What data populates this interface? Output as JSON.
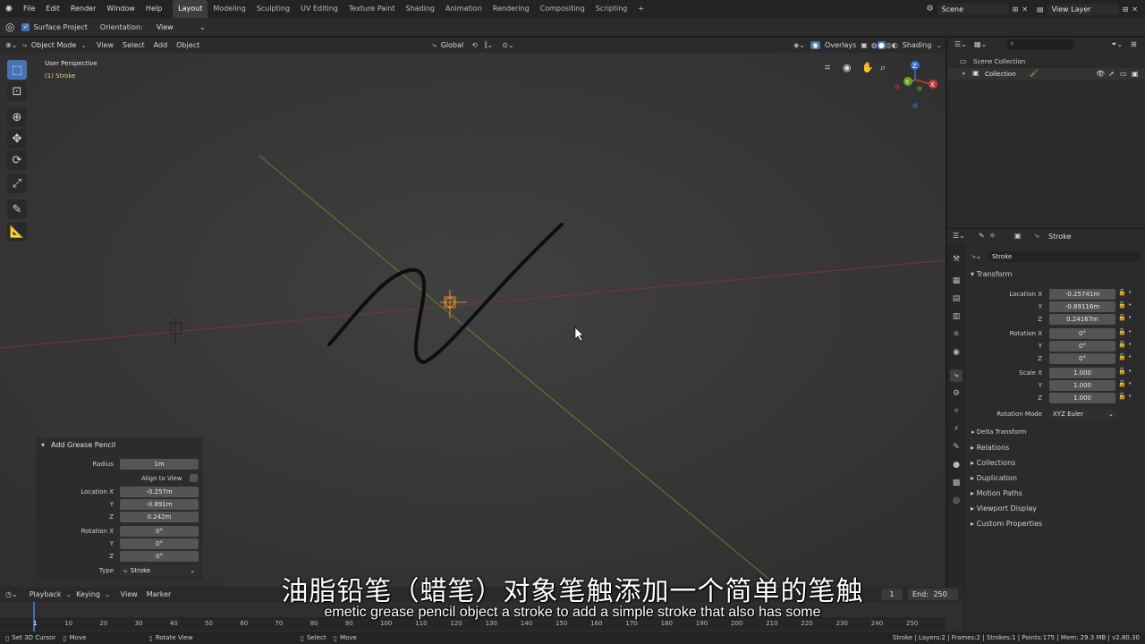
{
  "topbar": {
    "menus": [
      "File",
      "Edit",
      "Render",
      "Window",
      "Help"
    ],
    "workspaces": [
      "Layout",
      "Modeling",
      "Sculpting",
      "UV Editing",
      "Texture Paint",
      "Shading",
      "Animation",
      "Rendering",
      "Compositing",
      "Scripting"
    ],
    "add_tab": "+",
    "scene": "Scene",
    "view_layer": "View Layer"
  },
  "toolsettings": {
    "surface_project": "Surface Project",
    "orientation_label": "Orientation:",
    "orientation_value": "View"
  },
  "viewport_header": {
    "mode": "Object Mode",
    "menus": [
      "View",
      "Select",
      "Add",
      "Object"
    ],
    "transform": "Global",
    "overlays": "Overlays",
    "shading": "Shading"
  },
  "viewport": {
    "perspective": "User Perspective",
    "object_info": "(1) Stroke",
    "gizmo": {
      "x": "X",
      "y": "Y",
      "z": "Z"
    }
  },
  "operator_panel": {
    "title": "Add Grease Pencil",
    "radius_label": "Radius",
    "radius": "1m",
    "align_label": "Align to View",
    "location_x_label": "Location X",
    "location_x": "-0.257m",
    "y_label": "Y",
    "location_y": "-0.891m",
    "z_label": "Z",
    "location_z": "0.242m",
    "rotation_x_label": "Rotation X",
    "rotation_x": "0°",
    "rotation_y": "0°",
    "rotation_z": "0°",
    "type_label": "Type",
    "type_value": "Stroke"
  },
  "outliner": {
    "scene_collection": "Scene Collection",
    "collection": "Collection"
  },
  "properties": {
    "header_object": "Stroke",
    "object_name": "Stroke",
    "transform": "Transform",
    "location_x_label": "Location X",
    "location_x": "-0.25741m",
    "location_y": "-0.89116m",
    "location_z": "0.24167m",
    "rotation_x_label": "Rotation X",
    "rotation_x": "0°",
    "rotation_y": "0°",
    "rotation_z": "0°",
    "scale_x_label": "Scale X",
    "scale_x": "1.000",
    "scale_y": "1.000",
    "scale_z": "1.000",
    "y_label": "Y",
    "z_label": "Z",
    "rotation_mode_label": "Rotation Mode",
    "rotation_mode": "XYZ Euler",
    "delta_transform": "Delta Transform",
    "sections": [
      "Relations",
      "Collections",
      "Duplication",
      "Motion Paths",
      "Viewport Display",
      "Custom Properties"
    ]
  },
  "timeline": {
    "menus": [
      "Playback",
      "Keying",
      "View",
      "Marker"
    ],
    "current_frame": "1",
    "end_label": "End:",
    "end": "250",
    "frame_ticks": [
      "1",
      "10",
      "20",
      "30",
      "40",
      "50",
      "60",
      "70",
      "80",
      "90",
      "100",
      "110",
      "120",
      "130",
      "140",
      "150",
      "160",
      "170",
      "180",
      "190",
      "200",
      "210",
      "220",
      "230",
      "240",
      "250"
    ]
  },
  "statusbar": {
    "set_cursor": "Set 3D Cursor",
    "move1": "Move",
    "rotate_view": "Rotate View",
    "select": "Select",
    "move2": "Move",
    "stats": "Stroke | Layers:2 | Frames:2 | Strokes:1 | Points:175 | Mem: 29.3 MB | v2.80.30"
  },
  "subtitles": {
    "chinese": "油脂铅笔（蜡笔）对象笔触添加一个简单的笔触",
    "english": "emetic grease pencil object a stroke to add a simple stroke that also has some"
  },
  "colors": {
    "accent": "#4772b3",
    "x_axis": "#8a3a3a",
    "y_axis": "#7f8a2a"
  }
}
